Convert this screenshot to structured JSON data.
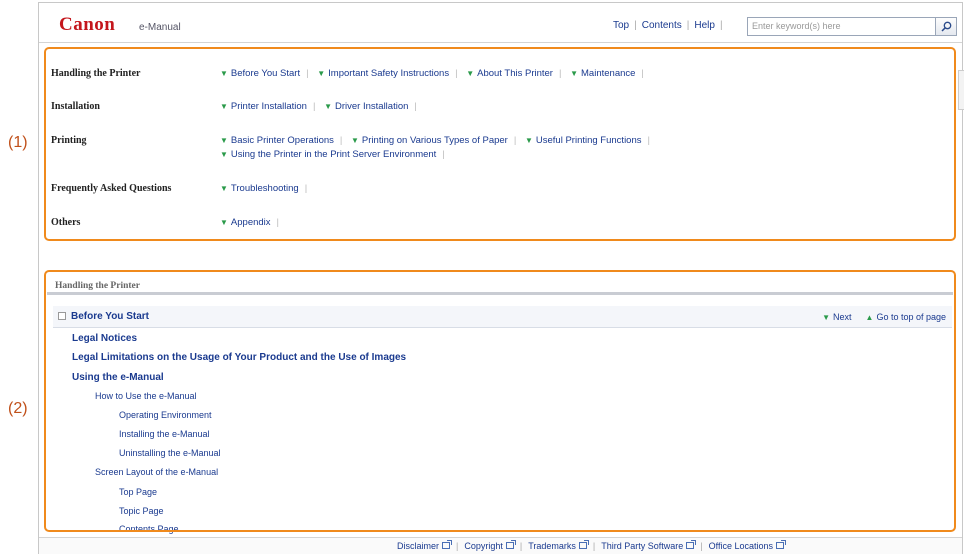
{
  "header": {
    "logo": "Canon",
    "subtitle": "e-Manual",
    "links": [
      "Top",
      "Contents",
      "Help"
    ],
    "search_placeholder": "Enter keyword(s) here"
  },
  "callouts": {
    "one": "(1)",
    "two": "(2)"
  },
  "categories": [
    {
      "name": "Handling the Printer",
      "links": [
        "Before You Start",
        "Important Safety Instructions",
        "About This Printer",
        "Maintenance"
      ]
    },
    {
      "name": "Installation",
      "links": [
        "Printer Installation",
        "Driver Installation"
      ]
    },
    {
      "name": "Printing",
      "links": [
        "Basic Printer Operations",
        "Printing on Various Types of Paper",
        "Useful Printing Functions"
      ],
      "links2": [
        "Using the Printer in the Print Server Environment"
      ]
    },
    {
      "name": "Frequently Asked Questions",
      "links": [
        "Troubleshooting"
      ]
    },
    {
      "name": "Others",
      "links": [
        "Appendix"
      ]
    }
  ],
  "topic": {
    "section_title": "Handling the Printer",
    "sub_title": "Before You Start",
    "next_label": "Next",
    "top_label": "Go to top of page",
    "toc": [
      {
        "level": 1,
        "text": "Legal Notices"
      },
      {
        "level": 1,
        "text": "Legal Limitations on the Usage of Your Product and the Use of Images"
      },
      {
        "level": 1,
        "text": "Using the e-Manual"
      },
      {
        "level": 2,
        "text": "How to Use the e-Manual"
      },
      {
        "level": 3,
        "text": "Operating Environment"
      },
      {
        "level": 3,
        "text": "Installing the e-Manual"
      },
      {
        "level": 3,
        "text": "Uninstalling the e-Manual"
      },
      {
        "level": 2,
        "text": "Screen Layout of the e-Manual"
      },
      {
        "level": 3,
        "text": "Top Page"
      },
      {
        "level": 3,
        "text": "Topic Page"
      },
      {
        "level": 3,
        "text": "Contents Page"
      }
    ]
  },
  "footer": {
    "links": [
      "Disclaimer",
      "Copyright",
      "Trademarks",
      "Third Party Software",
      "Office Locations"
    ]
  },
  "colors": {
    "accent": "#f08a1c",
    "link": "#1a3a8f",
    "brand": "#c4161c"
  }
}
